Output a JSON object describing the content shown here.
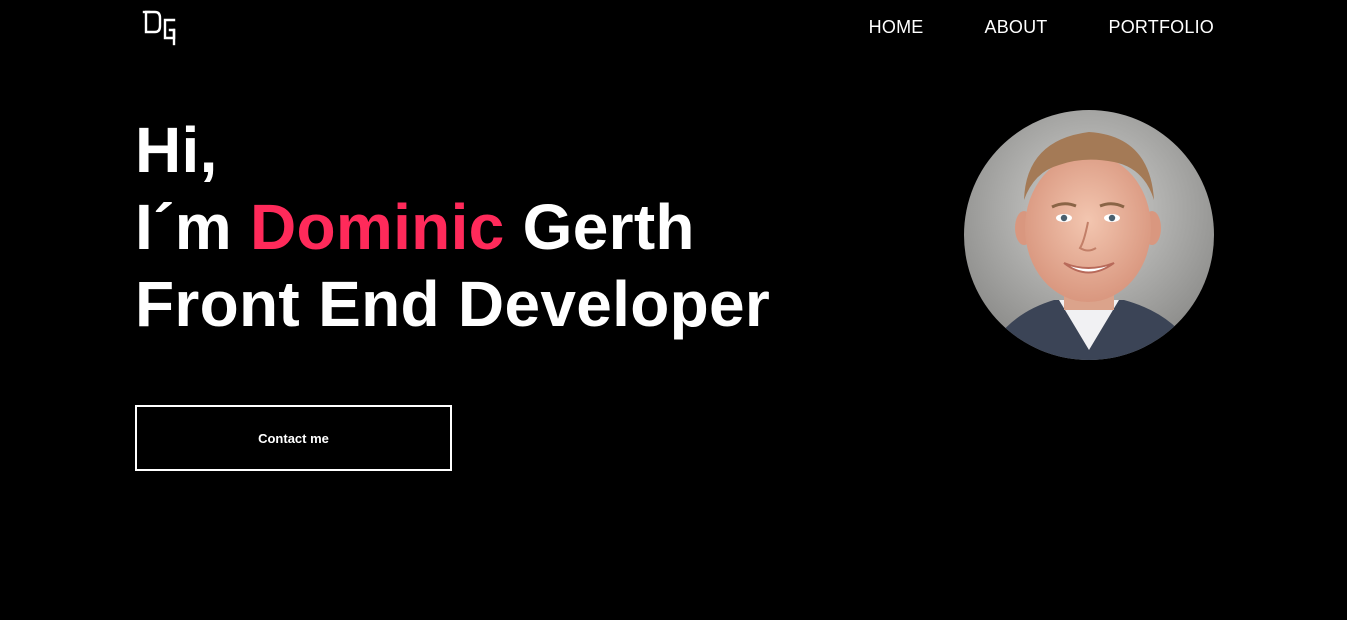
{
  "header": {
    "logo_text": "DG",
    "nav": [
      {
        "label": "HOME"
      },
      {
        "label": "ABOUT"
      },
      {
        "label": "PORTFOLIO"
      }
    ]
  },
  "hero": {
    "greeting": "Hi,",
    "intro_prefix": "I´m ",
    "first_name": "Dominic",
    "last_name": " Gerth",
    "role": "Front End Developer",
    "contact_button": "Contact me"
  },
  "colors": {
    "background": "#000000",
    "text": "#ffffff",
    "accent": "#ff2a5a"
  },
  "icons": {
    "logo": "dg-monogram-logo",
    "avatar": "profile-photo"
  }
}
